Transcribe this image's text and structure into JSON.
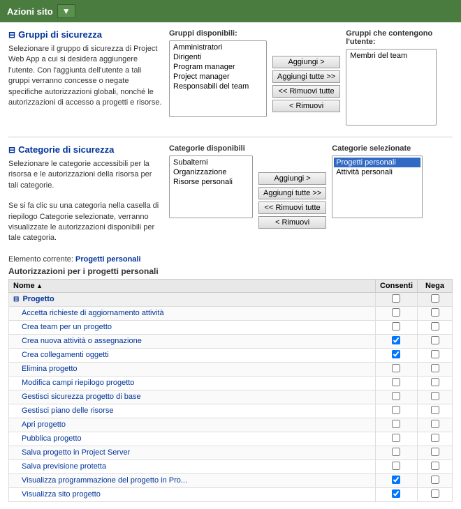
{
  "toolbar": {
    "title": "Azioni sito",
    "dropdown_label": "▼"
  },
  "security_groups": {
    "title": "Gruppi di sicurezza",
    "description": "Selezionare il gruppo di sicurezza di Project Web App a cui si desidera aggiungere l'utente. Con l'aggiunta dell'utente a tali gruppi verranno concesse o negate specifiche autorizzazioni globali, nonché le autorizzazioni di accesso a progetti e risorse.",
    "available_label": "Gruppi disponibili:",
    "selected_label": "Gruppi che contengono l'utente:",
    "available_options": [
      "Amministratori",
      "Dirigenti",
      "Program manager",
      "Project manager",
      "Responsabili del team"
    ],
    "selected_options": [
      "Membri del team"
    ],
    "btn_add": "Aggiungi >",
    "btn_add_all": "Aggiungi tutte >>",
    "btn_remove_all": "<< Rimuovi tutte",
    "btn_remove": "< Rimuovi"
  },
  "security_categories": {
    "title": "Categorie di sicurezza",
    "description": "Selezionare le categorie accessibili per la risorsa e le autorizzazioni della risorsa per tali categorie.",
    "description2": "Se si fa clic su una categoria nella casella di riepilogo Categorie selezionate, verranno visualizzate le autorizzazioni disponibili per tale categoria.",
    "available_label": "Categorie disponibili",
    "selected_label": "Categorie selezionate",
    "available_options": [
      "Subalterni",
      "Organizzazione",
      "Risorse personali"
    ],
    "selected_options": [
      "Progetti personali",
      "Attività personali"
    ],
    "selected_highlight": "Progetti personali",
    "btn_add": "Aggiungi >",
    "btn_add_all": "Aggiungi tutte >>",
    "btn_remove_all": "<< Rimuovi tutte",
    "btn_remove": "< Rimuovi"
  },
  "permissions": {
    "element_current_label": "Elemento corrente:",
    "element_current_value": "Progetti personali",
    "title": "Autorizzazioni per i progetti personali",
    "col_name": "Nome",
    "col_consenti": "Consenti",
    "col_nega": "Nega",
    "group_row": "Progetto",
    "rows": [
      {
        "name": "Accetta richieste di aggiornamento attività",
        "consenti": false,
        "nega": false
      },
      {
        "name": "Crea team per un progetto",
        "consenti": false,
        "nega": false
      },
      {
        "name": "Crea nuova attività o assegnazione",
        "consenti": true,
        "nega": false
      },
      {
        "name": "Crea collegamenti oggetti",
        "consenti": true,
        "nega": false
      },
      {
        "name": "Elimina progetto",
        "consenti": false,
        "nega": false
      },
      {
        "name": "Modifica campi riepilogo progetto",
        "consenti": false,
        "nega": false
      },
      {
        "name": "Gestisci sicurezza progetto di base",
        "consenti": false,
        "nega": false
      },
      {
        "name": "Gestisci piano delle risorse",
        "consenti": false,
        "nega": false
      },
      {
        "name": "Apri progetto",
        "consenti": false,
        "nega": false
      },
      {
        "name": "Pubblica progetto",
        "consenti": false,
        "nega": false
      },
      {
        "name": "Salva progetto in Project Server",
        "consenti": false,
        "nega": false
      },
      {
        "name": "Salva previsione protetta",
        "consenti": false,
        "nega": false
      },
      {
        "name": "Visualizza programmazione del progetto in Pro...",
        "consenti": true,
        "nega": false
      },
      {
        "name": "Visualizza sito progetto",
        "consenti": true,
        "nega": false
      }
    ]
  }
}
